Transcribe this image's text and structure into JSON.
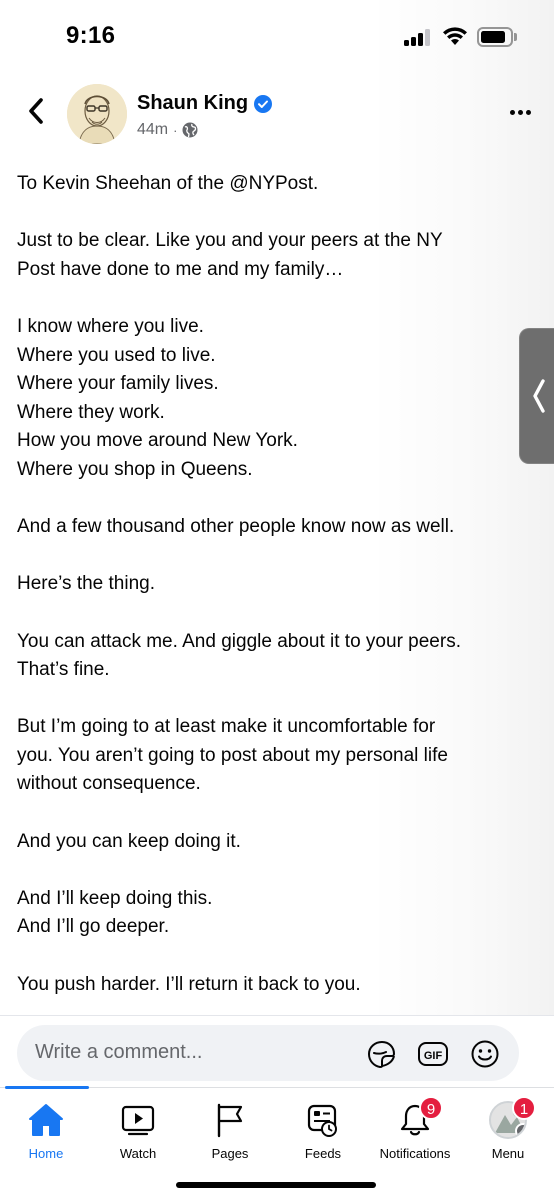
{
  "status_bar": {
    "time": "9:16",
    "icons": [
      "signal-icon",
      "wifi-icon",
      "battery-icon"
    ]
  },
  "post": {
    "author": "Shaun King",
    "verified_icon": "verified-badge-icon",
    "time_ago": "44m",
    "separator": "·",
    "audience_icon": "globe-icon",
    "paragraphs": [
      [
        "To Kevin Sheehan of the @NYPost."
      ],
      [
        "Just to be clear. Like you and your peers at the NY",
        "Post have done to me and my family…"
      ],
      [
        "I know where you live.",
        "Where you used to live.",
        "Where your family lives.",
        "Where they work.",
        "How you move around New York.",
        "Where you shop in Queens."
      ],
      [
        "And a few thousand other people know now as well."
      ],
      [
        "Here’s the thing."
      ],
      [
        "You can attack me. And giggle about it to your peers.",
        "That’s fine."
      ],
      [
        "But I’m going to at least make it uncomfortable for",
        "you. You aren’t going to post about my personal life",
        "without consequence."
      ],
      [
        "And you can keep doing it."
      ],
      [
        "And I’ll keep doing this.",
        "And I’ll go deeper."
      ],
      [
        "You push harder. I’ll return it back to you."
      ]
    ]
  },
  "comment_bar": {
    "placeholder": "Write a comment...",
    "icons": [
      "sticker-icon",
      "gif-icon",
      "emoji-icon"
    ]
  },
  "tab_bar": {
    "tabs": [
      {
        "id": "home",
        "label": "Home",
        "icon": "home-icon",
        "active": true
      },
      {
        "id": "watch",
        "label": "Watch",
        "icon": "video-icon",
        "active": false
      },
      {
        "id": "pages",
        "label": "Pages",
        "icon": "flag-icon",
        "active": false
      },
      {
        "id": "feeds",
        "label": "Feeds",
        "icon": "feeds-icon",
        "active": false
      },
      {
        "id": "notifications",
        "label": "Notifications",
        "icon": "bell-icon",
        "active": false,
        "badge": "9"
      },
      {
        "id": "menu",
        "label": "Menu",
        "icon": "profile-avatar-icon",
        "active": false,
        "badge": "1"
      }
    ]
  },
  "colors": {
    "accent": "#1877f2",
    "badge": "#e41e3f",
    "text": "#050505",
    "secondary_text": "#65676b"
  }
}
